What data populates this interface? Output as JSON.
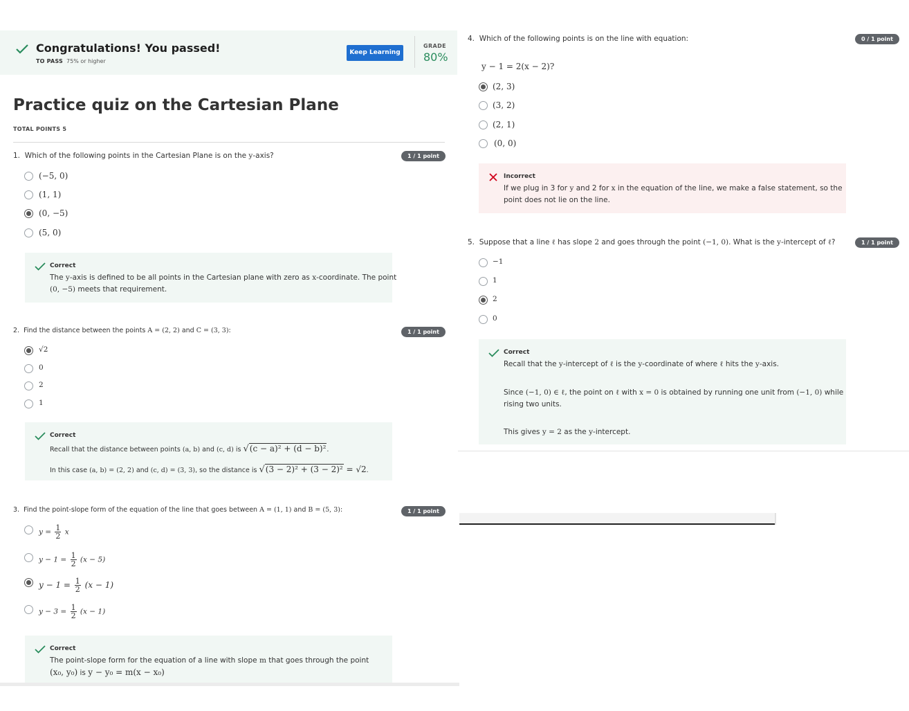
{
  "banner": {
    "title": "Congratulations! You passed!",
    "to_pass_label": "TO PASS",
    "to_pass_value": "75% or higher",
    "keep_learning": "Keep Learning",
    "grade_label": "GRADE",
    "grade_value": "80%"
  },
  "quiz": {
    "title": "Practice quiz on the Cartesian Plane",
    "total_points": "TOTAL POINTS 5"
  },
  "questions": {
    "q1": {
      "number": "1.",
      "text_pre": "Which of the following points in the Cartesian Plane is on the ",
      "text_var": "y",
      "text_post": "-axis?",
      "badge": "1 / 1 point",
      "options": [
        "(−5, 0)",
        "(1, 1)",
        "(0, −5)",
        "(5, 0)"
      ],
      "selected_index": 2,
      "feedback_label": "Correct",
      "feedback_l1_a": "The ",
      "feedback_l1_var": "y",
      "feedback_l1_b": "-axis is defined to be all points in the Cartesian plane with zero as ",
      "feedback_l1_var2": "x",
      "feedback_l1_c": "-coordinate. The point",
      "feedback_l2_math": "(0, −5)",
      "feedback_l2_text": " meets that requirement."
    },
    "q2": {
      "number": "2.",
      "text_pre": "Find the distance between the points ",
      "text_math1": "A = (2, 2)",
      "text_mid": " and ",
      "text_math2": "C = (3, 3)",
      "text_post": ":",
      "badge": "1 / 1 point",
      "options": [
        "√2",
        "0",
        "2",
        "1"
      ],
      "selected_index": 0,
      "feedback_label": "Correct",
      "feedback_l1_a": "Recall that the distance between points ",
      "feedback_l1_m1": "(a, b)",
      "feedback_l1_b": " and ",
      "feedback_l1_m2": "(c, d)",
      "feedback_l1_c": " is ",
      "feedback_l1_sqrt": "(c − a)² + (d − b)²",
      "feedback_l1_end": ".",
      "feedback_l2_a": "In this case ",
      "feedback_l2_m1": "(a, b) = (2, 2)",
      "feedback_l2_b": " and ",
      "feedback_l2_m2": "(c, d) = (3, 3)",
      "feedback_l2_c": ", so the distance is ",
      "feedback_l2_sqrt": "(3 − 2)² + (3 − 2)²",
      "feedback_l2_eq": " = √2",
      "feedback_l2_end": "."
    },
    "q3": {
      "number": "3.",
      "text_pre": "Find the point-slope form of the equation of the line that goes between ",
      "text_math1": "A = (1, 1)",
      "text_mid": " and ",
      "text_math2": "B = (5, 3)",
      "text_post": ":",
      "badge": "1 / 1 point",
      "options": [
        {
          "lhs": "y =",
          "num": "1",
          "den": "2",
          "rhs": "x"
        },
        {
          "lhs": "y − 1 =",
          "num": "1",
          "den": "2",
          "rhs": "(x − 5)"
        },
        {
          "lhs": "y − 1 =",
          "num": "1",
          "den": "2",
          "rhs": "(x − 1)"
        },
        {
          "lhs": "y − 3 =",
          "num": "1",
          "den": "2",
          "rhs": "(x − 1)"
        }
      ],
      "selected_index": 2,
      "feedback_label": "Correct",
      "feedback_l1_a": "The point-slope form for the equation of a line with slope ",
      "feedback_l1_var": "m",
      "feedback_l1_b": " that goes through the point",
      "feedback_l2_m1": "(x₀, y₀)",
      "feedback_l2_a": " is ",
      "feedback_l2_m2": "y − y₀ = m(x − x₀)"
    },
    "q4": {
      "number": "4.",
      "text": "Which of the following points is on the line with equation:",
      "equation": "y − 1 = 2(x − 2)?",
      "badge": "0 / 1 point",
      "options": [
        "(2, 3)",
        "(3, 2)",
        "(2, 1)",
        "(0, 0)"
      ],
      "selected_index": 0,
      "feedback_label": "Incorrect",
      "feedback_l1_a": "If we plug in 3 for ",
      "feedback_l1_var": "y",
      "feedback_l1_b": " and 2 for ",
      "feedback_l1_var2": "x",
      "feedback_l1_c": " in the equation of the line, we make a false statement, so the",
      "feedback_l2": "point does not lie on the line."
    },
    "q5": {
      "number": "5.",
      "text_a": "Suppose that a line ",
      "text_ell": "ℓ",
      "text_b": " has slope ",
      "text_m2": "2",
      "text_c": " and goes through the point ",
      "text_pt": "(−1, 0)",
      "text_d": ". What is the ",
      "text_y": "y",
      "text_e": "-intercept of ",
      "text_ell2": "ℓ",
      "text_f": "?",
      "badge": "1 / 1 point",
      "options": [
        "−1",
        "1",
        "2",
        "0"
      ],
      "selected_index": 2,
      "feedback_label": "Correct",
      "feedback_l1_a": "Recall that the ",
      "feedback_l1_y": "y",
      "feedback_l1_b": "-intercept of ",
      "feedback_l1_ell": "ℓ",
      "feedback_l1_c": " is the ",
      "feedback_l1_y2": "y",
      "feedback_l1_d": "-coordinate of where ",
      "feedback_l1_ell2": "ℓ",
      "feedback_l1_e": " hits the ",
      "feedback_l1_y3": "y",
      "feedback_l1_f": "-axis.",
      "feedback_l2_a": "Since ",
      "feedback_l2_m1": "(−1, 0) ∈ ℓ",
      "feedback_l2_b": ", the point on ",
      "feedback_l2_ell": "ℓ",
      "feedback_l2_c": " with ",
      "feedback_l2_m2": "x = 0",
      "feedback_l2_d": " is obtained by running one unit from ",
      "feedback_l2_m3": "(−1, 0)",
      "feedback_l2_e": " while",
      "feedback_l3": "rising two units.",
      "feedback_l4_a": "This gives ",
      "feedback_l4_m": "y = 2",
      "feedback_l4_b": " as the ",
      "feedback_l4_y": "y",
      "feedback_l4_c": "-intercept."
    }
  },
  "colors": {
    "accent_blue": "#1f6fd0",
    "correct_green": "#2a8c5d",
    "incorrect_red": "#d0021b",
    "feedback_bg_correct": "#f1f7f4",
    "feedback_bg_incorrect": "#fcf0f0"
  }
}
